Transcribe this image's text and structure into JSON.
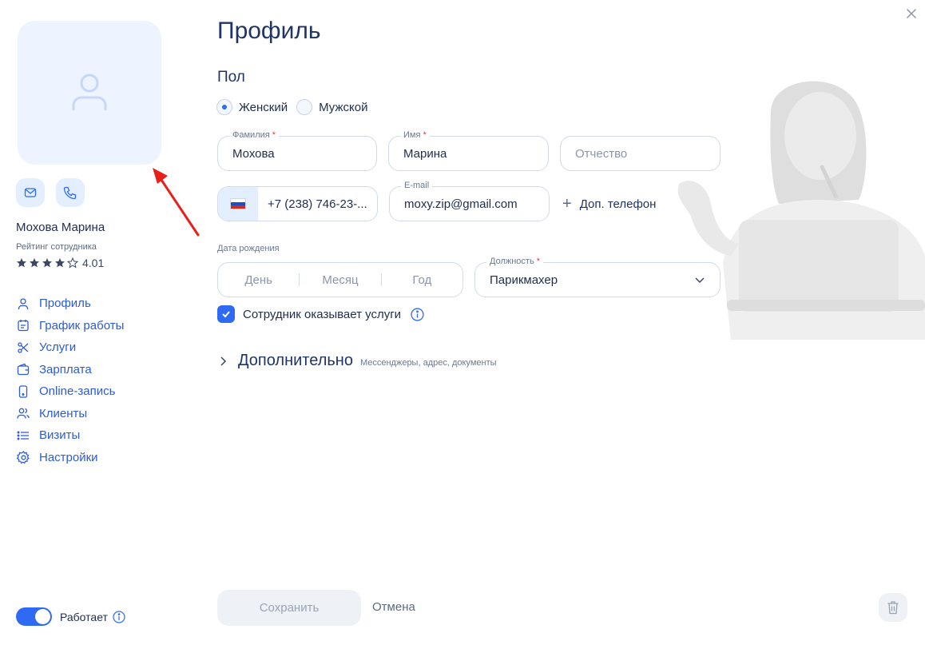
{
  "sidebar": {
    "employee_name": "Мохова Марина",
    "rating_label": "Рейтинг сотрудника",
    "rating_value": "4.01",
    "rating_stars": 4,
    "nav": [
      {
        "label": "Профиль",
        "icon": "user-icon"
      },
      {
        "label": "График работы",
        "icon": "calendar-icon"
      },
      {
        "label": "Услуги",
        "icon": "scissors-icon"
      },
      {
        "label": "Зарплата",
        "icon": "wallet-icon"
      },
      {
        "label": "Online-запись",
        "icon": "phone-device-icon"
      },
      {
        "label": "Клиенты",
        "icon": "users-icon"
      },
      {
        "label": "Визиты",
        "icon": "list-icon"
      },
      {
        "label": "Настройки",
        "icon": "gear-icon"
      }
    ],
    "works_label": "Работает",
    "works_on": true
  },
  "main": {
    "title": "Профиль",
    "gender_label": "Пол",
    "gender_options": [
      "Женский",
      "Мужской"
    ],
    "gender_selected": "Женский",
    "surname": {
      "label": "Фамилия",
      "value": "Мохова"
    },
    "name": {
      "label": "Имя",
      "value": "Марина"
    },
    "patronymic": {
      "placeholder": "Отчество"
    },
    "phone": {
      "value": "+7 (238) 746-23-..."
    },
    "email": {
      "label": "E-mail",
      "value": "moxy.zip@gmail.com"
    },
    "add_phone": "Доп. телефон",
    "dob_label": "Дата рождения",
    "dob": {
      "day": "День",
      "month": "Месяц",
      "year": "Год"
    },
    "position": {
      "label": "Должность",
      "value": "Парикмахер"
    },
    "provides_services": "Сотрудник оказывает услуги",
    "extra_title": "Дополнительно",
    "extra_hint": "Мессенджеры, адрес, документы"
  },
  "footer": {
    "save": "Сохранить",
    "cancel": "Отмена"
  },
  "colors": {
    "accent": "#2f6af5",
    "nav_text": "#2b5bd7",
    "avatar_bg": "#edf4ff",
    "required": "#e5364f"
  }
}
